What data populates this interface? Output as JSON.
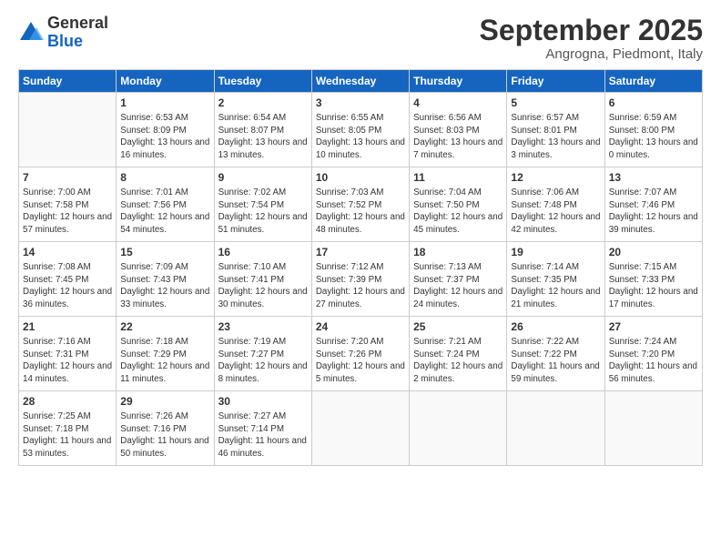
{
  "logo": {
    "general": "General",
    "blue": "Blue"
  },
  "header": {
    "month": "September 2025",
    "location": "Angrogna, Piedmont, Italy"
  },
  "weekdays": [
    "Sunday",
    "Monday",
    "Tuesday",
    "Wednesday",
    "Thursday",
    "Friday",
    "Saturday"
  ],
  "weeks": [
    [
      {
        "day": "",
        "sunrise": "",
        "sunset": "",
        "daylight": ""
      },
      {
        "day": "1",
        "sunrise": "Sunrise: 6:53 AM",
        "sunset": "Sunset: 8:09 PM",
        "daylight": "Daylight: 13 hours and 16 minutes."
      },
      {
        "day": "2",
        "sunrise": "Sunrise: 6:54 AM",
        "sunset": "Sunset: 8:07 PM",
        "daylight": "Daylight: 13 hours and 13 minutes."
      },
      {
        "day": "3",
        "sunrise": "Sunrise: 6:55 AM",
        "sunset": "Sunset: 8:05 PM",
        "daylight": "Daylight: 13 hours and 10 minutes."
      },
      {
        "day": "4",
        "sunrise": "Sunrise: 6:56 AM",
        "sunset": "Sunset: 8:03 PM",
        "daylight": "Daylight: 13 hours and 7 minutes."
      },
      {
        "day": "5",
        "sunrise": "Sunrise: 6:57 AM",
        "sunset": "Sunset: 8:01 PM",
        "daylight": "Daylight: 13 hours and 3 minutes."
      },
      {
        "day": "6",
        "sunrise": "Sunrise: 6:59 AM",
        "sunset": "Sunset: 8:00 PM",
        "daylight": "Daylight: 13 hours and 0 minutes."
      }
    ],
    [
      {
        "day": "7",
        "sunrise": "Sunrise: 7:00 AM",
        "sunset": "Sunset: 7:58 PM",
        "daylight": "Daylight: 12 hours and 57 minutes."
      },
      {
        "day": "8",
        "sunrise": "Sunrise: 7:01 AM",
        "sunset": "Sunset: 7:56 PM",
        "daylight": "Daylight: 12 hours and 54 minutes."
      },
      {
        "day": "9",
        "sunrise": "Sunrise: 7:02 AM",
        "sunset": "Sunset: 7:54 PM",
        "daylight": "Daylight: 12 hours and 51 minutes."
      },
      {
        "day": "10",
        "sunrise": "Sunrise: 7:03 AM",
        "sunset": "Sunset: 7:52 PM",
        "daylight": "Daylight: 12 hours and 48 minutes."
      },
      {
        "day": "11",
        "sunrise": "Sunrise: 7:04 AM",
        "sunset": "Sunset: 7:50 PM",
        "daylight": "Daylight: 12 hours and 45 minutes."
      },
      {
        "day": "12",
        "sunrise": "Sunrise: 7:06 AM",
        "sunset": "Sunset: 7:48 PM",
        "daylight": "Daylight: 12 hours and 42 minutes."
      },
      {
        "day": "13",
        "sunrise": "Sunrise: 7:07 AM",
        "sunset": "Sunset: 7:46 PM",
        "daylight": "Daylight: 12 hours and 39 minutes."
      }
    ],
    [
      {
        "day": "14",
        "sunrise": "Sunrise: 7:08 AM",
        "sunset": "Sunset: 7:45 PM",
        "daylight": "Daylight: 12 hours and 36 minutes."
      },
      {
        "day": "15",
        "sunrise": "Sunrise: 7:09 AM",
        "sunset": "Sunset: 7:43 PM",
        "daylight": "Daylight: 12 hours and 33 minutes."
      },
      {
        "day": "16",
        "sunrise": "Sunrise: 7:10 AM",
        "sunset": "Sunset: 7:41 PM",
        "daylight": "Daylight: 12 hours and 30 minutes."
      },
      {
        "day": "17",
        "sunrise": "Sunrise: 7:12 AM",
        "sunset": "Sunset: 7:39 PM",
        "daylight": "Daylight: 12 hours and 27 minutes."
      },
      {
        "day": "18",
        "sunrise": "Sunrise: 7:13 AM",
        "sunset": "Sunset: 7:37 PM",
        "daylight": "Daylight: 12 hours and 24 minutes."
      },
      {
        "day": "19",
        "sunrise": "Sunrise: 7:14 AM",
        "sunset": "Sunset: 7:35 PM",
        "daylight": "Daylight: 12 hours and 21 minutes."
      },
      {
        "day": "20",
        "sunrise": "Sunrise: 7:15 AM",
        "sunset": "Sunset: 7:33 PM",
        "daylight": "Daylight: 12 hours and 17 minutes."
      }
    ],
    [
      {
        "day": "21",
        "sunrise": "Sunrise: 7:16 AM",
        "sunset": "Sunset: 7:31 PM",
        "daylight": "Daylight: 12 hours and 14 minutes."
      },
      {
        "day": "22",
        "sunrise": "Sunrise: 7:18 AM",
        "sunset": "Sunset: 7:29 PM",
        "daylight": "Daylight: 12 hours and 11 minutes."
      },
      {
        "day": "23",
        "sunrise": "Sunrise: 7:19 AM",
        "sunset": "Sunset: 7:27 PM",
        "daylight": "Daylight: 12 hours and 8 minutes."
      },
      {
        "day": "24",
        "sunrise": "Sunrise: 7:20 AM",
        "sunset": "Sunset: 7:26 PM",
        "daylight": "Daylight: 12 hours and 5 minutes."
      },
      {
        "day": "25",
        "sunrise": "Sunrise: 7:21 AM",
        "sunset": "Sunset: 7:24 PM",
        "daylight": "Daylight: 12 hours and 2 minutes."
      },
      {
        "day": "26",
        "sunrise": "Sunrise: 7:22 AM",
        "sunset": "Sunset: 7:22 PM",
        "daylight": "Daylight: 11 hours and 59 minutes."
      },
      {
        "day": "27",
        "sunrise": "Sunrise: 7:24 AM",
        "sunset": "Sunset: 7:20 PM",
        "daylight": "Daylight: 11 hours and 56 minutes."
      }
    ],
    [
      {
        "day": "28",
        "sunrise": "Sunrise: 7:25 AM",
        "sunset": "Sunset: 7:18 PM",
        "daylight": "Daylight: 11 hours and 53 minutes."
      },
      {
        "day": "29",
        "sunrise": "Sunrise: 7:26 AM",
        "sunset": "Sunset: 7:16 PM",
        "daylight": "Daylight: 11 hours and 50 minutes."
      },
      {
        "day": "30",
        "sunrise": "Sunrise: 7:27 AM",
        "sunset": "Sunset: 7:14 PM",
        "daylight": "Daylight: 11 hours and 46 minutes."
      },
      {
        "day": "",
        "sunrise": "",
        "sunset": "",
        "daylight": ""
      },
      {
        "day": "",
        "sunrise": "",
        "sunset": "",
        "daylight": ""
      },
      {
        "day": "",
        "sunrise": "",
        "sunset": "",
        "daylight": ""
      },
      {
        "day": "",
        "sunrise": "",
        "sunset": "",
        "daylight": ""
      }
    ]
  ]
}
